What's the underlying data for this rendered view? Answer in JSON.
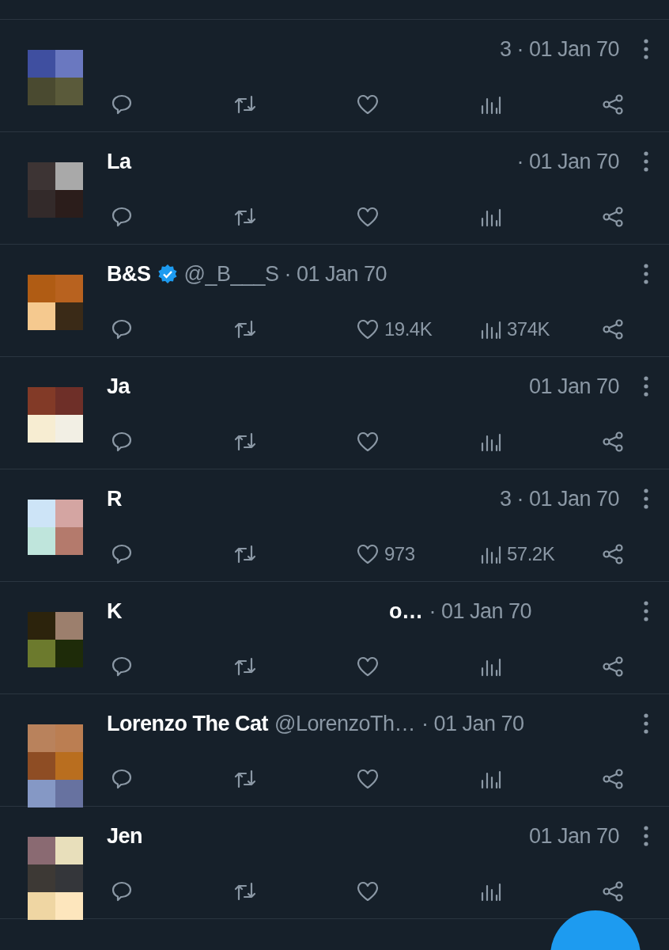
{
  "tweets": [
    {
      "meta": "3 · 01 Jan 70"
    },
    {
      "name": "La",
      "meta": "· 01 Jan 70"
    },
    {
      "name": "B&S",
      "verified": true,
      "meta": "@_B___S · 01 Jan 70",
      "actions": {
        "likes": "19.4K",
        "views": "374K"
      }
    },
    {
      "name": "Ja",
      "meta": "01 Jan 70"
    },
    {
      "name": "R",
      "meta": "3 · 01 Jan 70",
      "actions": {
        "likes": "973",
        "views": "57.2K"
      }
    },
    {
      "name": "K",
      "name_tail": "o…",
      "meta": "· 01 Jan 70"
    },
    {
      "name": "Lorenzo The Cat",
      "handle": "@LorenzoTh…",
      "meta": "· 01 Jan 70"
    },
    {
      "name": "Jen",
      "meta": "01 Jan 70"
    }
  ],
  "compose_button": {
    "kind": "fab"
  }
}
